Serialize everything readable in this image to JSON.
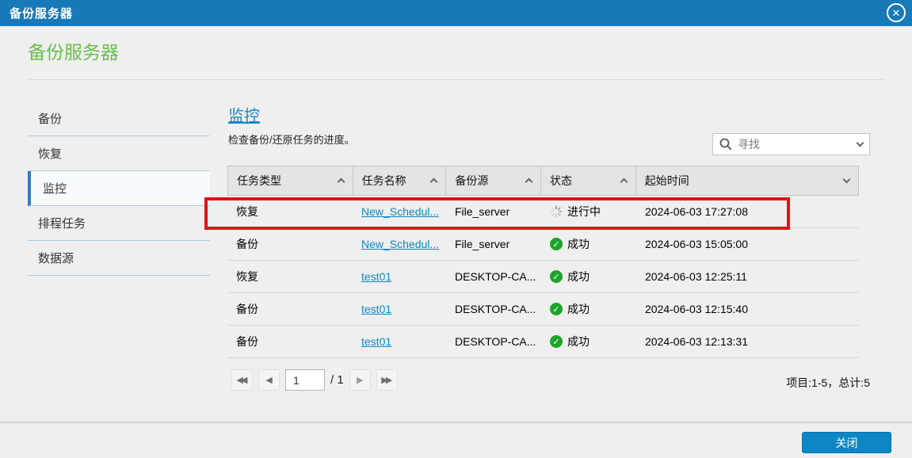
{
  "titlebar": {
    "title": "备份服务器"
  },
  "page": {
    "title": "备份服务器"
  },
  "sidebar": {
    "items": [
      {
        "label": "备份",
        "selected": false
      },
      {
        "label": "恢复",
        "selected": false
      },
      {
        "label": "监控",
        "selected": true
      },
      {
        "label": "排程任务",
        "selected": false
      },
      {
        "label": "数据源",
        "selected": false
      }
    ]
  },
  "main": {
    "heading": "监控",
    "description": "检查备份/还原任务的进度。",
    "search": {
      "placeholder": "寻找"
    },
    "table": {
      "columns": [
        {
          "label": "任务类型",
          "sort": "up"
        },
        {
          "label": "任务名称",
          "sort": "up"
        },
        {
          "label": "备份源",
          "sort": "up"
        },
        {
          "label": "状态",
          "sort": "up"
        },
        {
          "label": "起始时间",
          "sort": "down"
        }
      ],
      "rows": [
        {
          "type": "恢复",
          "name": "New_Schedul...",
          "source": "File_server",
          "status": "进行中",
          "status_kind": "running",
          "time": "2024-06-03 17:27:08",
          "highlighted": true
        },
        {
          "type": "备份",
          "name": "New_Schedul...",
          "source": "File_server",
          "status": "成功",
          "status_kind": "success",
          "time": "2024-06-03 15:05:00",
          "highlighted": false
        },
        {
          "type": "恢复",
          "name": "test01",
          "source": "DESKTOP-CA...",
          "status": "成功",
          "status_kind": "success",
          "time": "2024-06-03 12:25:11",
          "highlighted": false
        },
        {
          "type": "备份",
          "name": "test01",
          "source": "DESKTOP-CA...",
          "status": "成功",
          "status_kind": "success",
          "time": "2024-06-03 12:15:40",
          "highlighted": false
        },
        {
          "type": "备份",
          "name": "test01",
          "source": "DESKTOP-CA...",
          "status": "成功",
          "status_kind": "success",
          "time": "2024-06-03 12:13:31",
          "highlighted": false
        }
      ]
    },
    "pagination": {
      "current_page": "1",
      "total_label": "/ 1",
      "summary": "项目:1-5，总计:5"
    }
  },
  "footer": {
    "close_label": "关闭"
  },
  "icons": {
    "close_glyph": "✕",
    "check_glyph": "✓",
    "prev_glyph": "◀",
    "next_glyph": "▶"
  },
  "colors": {
    "titlebar_blue": "#1879b8",
    "button_blue": "#0e86c4",
    "link_blue": "#0e86c4",
    "title_green": "#67bf48",
    "success_green": "#1ca32a",
    "annotation_red": "#e31212"
  }
}
